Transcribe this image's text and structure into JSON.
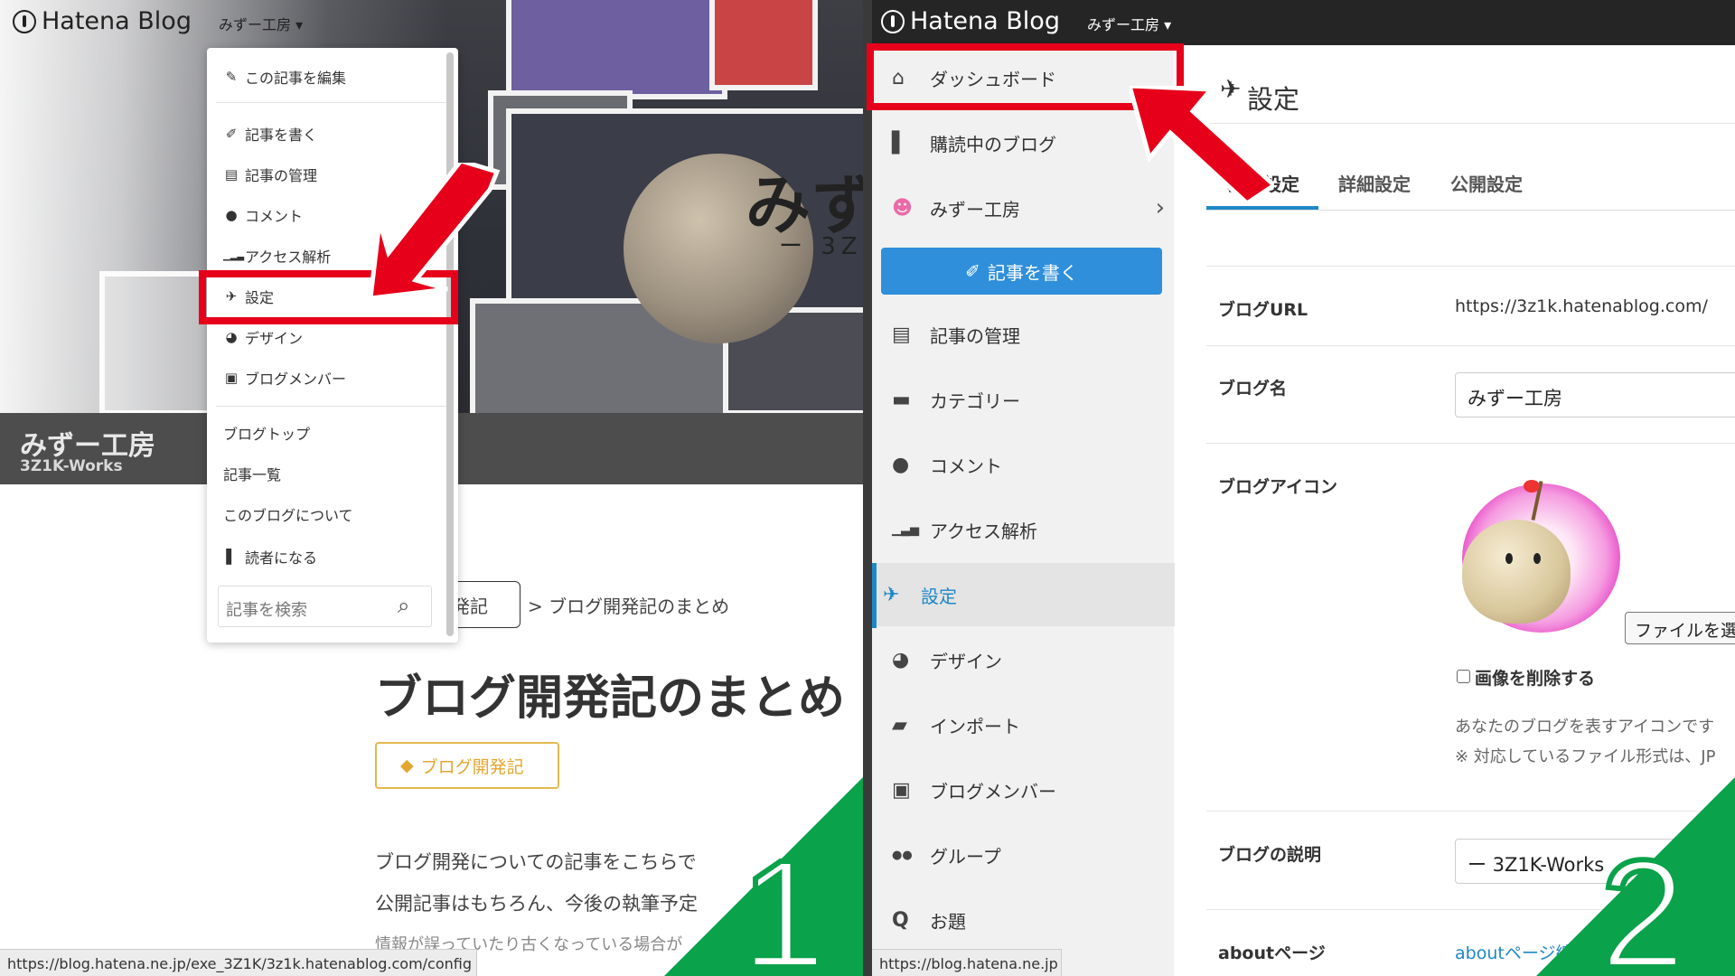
{
  "left": {
    "header": {
      "logo_text": "Hatena Blog",
      "user_menu": "みずー工房 ▾"
    },
    "hero": {
      "title": "みず",
      "subtitle": "ー 3Z"
    },
    "blog": {
      "name": "みずー工房",
      "id": "3Z1K-Works"
    },
    "menu": {
      "items": [
        {
          "icon": "pencil-icon",
          "glyph": "✎",
          "label": "この記事を編集"
        },
        {
          "icon": "edit-icon",
          "glyph": "✐",
          "label": "記事を書く"
        },
        {
          "icon": "document-icon",
          "glyph": "▤",
          "label": "記事の管理"
        },
        {
          "icon": "comment-icon",
          "glyph": "●",
          "label": "コメント"
        },
        {
          "icon": "signal-icon",
          "glyph": "▁▂▃",
          "label": "アクセス解析"
        },
        {
          "icon": "wrench-icon",
          "glyph": "✈",
          "label": "設定"
        },
        {
          "icon": "palette-icon",
          "glyph": "◕",
          "label": "デザイン"
        },
        {
          "icon": "members-icon",
          "glyph": "▣",
          "label": "ブログメンバー"
        },
        {
          "label": "ブログトップ"
        },
        {
          "label": "記事一覧"
        },
        {
          "label": "このブログについて"
        },
        {
          "icon": "bookmark-icon",
          "glyph": "▌",
          "label": "読者になる"
        }
      ],
      "search_placeholder": "記事を検索"
    },
    "breadcrumb": {
      "category": "発記",
      "separator": ">",
      "current": "ブログ開発記のまとめ"
    },
    "post": {
      "title": "ブログ開発記のまとめ",
      "tag": "ブログ開発記",
      "lines": [
        "ブログ開発についての記事をこちらで",
        "公開記事はもちろん、今後の執筆予定",
        "情報が誤っていたり古くなっている場合が"
      ]
    },
    "status_url": "https://blog.hatena.ne.jp/exe_3Z1K/3z1k.hatenablog.com/config",
    "step_number": "1"
  },
  "right": {
    "header": {
      "logo_text": "Hatena Blog",
      "user_menu": "みずー工房 ▾"
    },
    "sidebar": {
      "items": [
        {
          "icon": "home-icon",
          "glyph": "⌂",
          "label": "ダッシュボード"
        },
        {
          "icon": "bookmark-icon",
          "glyph": "▌",
          "label": "購読中のブログ"
        },
        {
          "icon": "blog-avatar-icon",
          "glyph": "☻",
          "label": "みずー工房",
          "chevron": "›"
        },
        {
          "icon": "document-icon",
          "glyph": "▤",
          "label": "記事の管理"
        },
        {
          "icon": "folder-icon",
          "glyph": "▬",
          "label": "カテゴリー"
        },
        {
          "icon": "comment-icon",
          "glyph": "●",
          "label": "コメント"
        },
        {
          "icon": "signal-icon",
          "glyph": "▁▃▅",
          "label": "アクセス解析"
        },
        {
          "icon": "wrench-icon",
          "glyph": "✈",
          "label": "設定"
        },
        {
          "icon": "palette-icon",
          "glyph": "◕",
          "label": "デザイン"
        },
        {
          "icon": "truck-icon",
          "glyph": "▰",
          "label": "インポート"
        },
        {
          "icon": "members-icon",
          "glyph": "▣",
          "label": "ブログメンバー"
        },
        {
          "icon": "group-icon",
          "glyph": "●●",
          "label": "グループ"
        },
        {
          "icon": "question-icon",
          "glyph": "Q",
          "label": "お題"
        }
      ],
      "write_button": "記事を書く",
      "write_glyph": "✐"
    },
    "settings": {
      "title": "設定",
      "title_glyph": "✈",
      "tabs": [
        "基本設定",
        "詳細設定",
        "公開設定"
      ],
      "blog_url_label": "ブログURL",
      "blog_url_value": "https://3z1k.hatenablog.com/",
      "blog_name_label": "ブログ名",
      "blog_name_value": "みずー工房",
      "blog_icon_label": "ブログアイコン",
      "file_button": "ファイルを選",
      "delete_image_label": "画像を削除する",
      "icon_desc": "あなたのブログを表すアイコンです",
      "icon_note": "※ 対応しているファイル形式は、JP",
      "description_label": "ブログの説明",
      "description_value": "ー 3Z1K-Works",
      "about_label": "aboutページ",
      "about_link": "aboutページ編"
    },
    "status_url": "https://blog.hatena.ne.jp",
    "step_number": "2"
  },
  "colors": {
    "highlight_red": "#e6001a",
    "step_green": "#0aa24a",
    "accent_blue": "#1e88c8",
    "tag_gold": "#e3a630"
  }
}
